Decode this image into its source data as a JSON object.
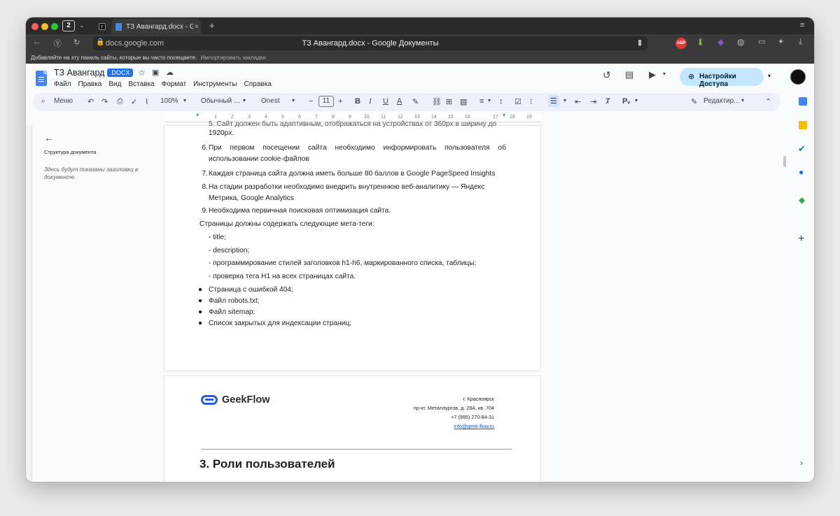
{
  "browser": {
    "tab_count": "2",
    "active_tab_title": "ТЗ Авангард.docx - Goo",
    "url": "docs.google.com",
    "window_title": "ТЗ Авангард.docx - Google Документы",
    "bookmarks_bar_text": "Добавляйте на эту панель сайты, которые вы часто посещаете.",
    "bookmarks_import_link": "Импортировать закладки"
  },
  "doc": {
    "title": "ТЗ Авангард",
    "badge": ".DOCX",
    "menus": [
      "Файл",
      "Правка",
      "Вид",
      "Вставка",
      "Формат",
      "Инструменты",
      "Справка"
    ],
    "share_label": "Настройки Доступа",
    "edit_mode": "Редактир..."
  },
  "toolbar": {
    "search_label": "Меню",
    "zoom": "100%",
    "style": "Обычный ...",
    "font": "Onest",
    "font_size": "11"
  },
  "ruler_ticks": [
    "1",
    "1",
    "2",
    "3",
    "4",
    "5",
    "6",
    "7",
    "8",
    "9",
    "10",
    "11",
    "12",
    "13",
    "14",
    "15",
    "16",
    "17",
    "18",
    "19"
  ],
  "outline": {
    "title": "Структура документа",
    "empty_text": "Здесь будут показаны заголовки в документе."
  },
  "page1": {
    "partial_top": "5. Сайт должен быть адаптивным, отображаться на устройствах от 360рх в ширину до",
    "partial_top2": "1920px.",
    "item6_num": "6.",
    "item6_line1": "При первом посещении сайта необходимо информировать пользователя об",
    "item6_line2": "использовании cookie-файлов",
    "item7_num": "7.",
    "item7": "Каждая страница сайта должна иметь больше 80 баллов в Google PageSpeed Insights",
    "item8_num": "8.",
    "item8_line1": "На стадии разработки необходимо внедрить внутреннюю веб-аналитику — Яндекс",
    "item8_line2": "Метрика, Google Analytics",
    "item9_num": "9.",
    "item9": "Необходима первичная поисковая оптимизация сайта.",
    "meta_intro": "Страницы должны содержать следующие мета-теги:",
    "meta_items": [
      "- title;",
      "- description;",
      "- программирование стилей заголовков h1-h6, маркированного списка, таблицы;",
      "- проверка тега H1 на всех страницах сайта."
    ],
    "bullets": [
      "Страница с ошибкой 404;",
      "Файл robots.txt;",
      "Файл sitemap;",
      "Список закрытых для индексации страниц;"
    ]
  },
  "page2": {
    "logo_text": "GeekFlow",
    "city": "г. Красноярск",
    "address": "пр-кт. Металлургов, д. 28А, кв. 704",
    "phone": "+7 (995) 270-84-31",
    "email": "info@geek-flow.ru",
    "heading": "3. Роли пользователей"
  },
  "colors": {
    "accent": "#1a73e8",
    "share_bg": "#c2e7ff"
  }
}
